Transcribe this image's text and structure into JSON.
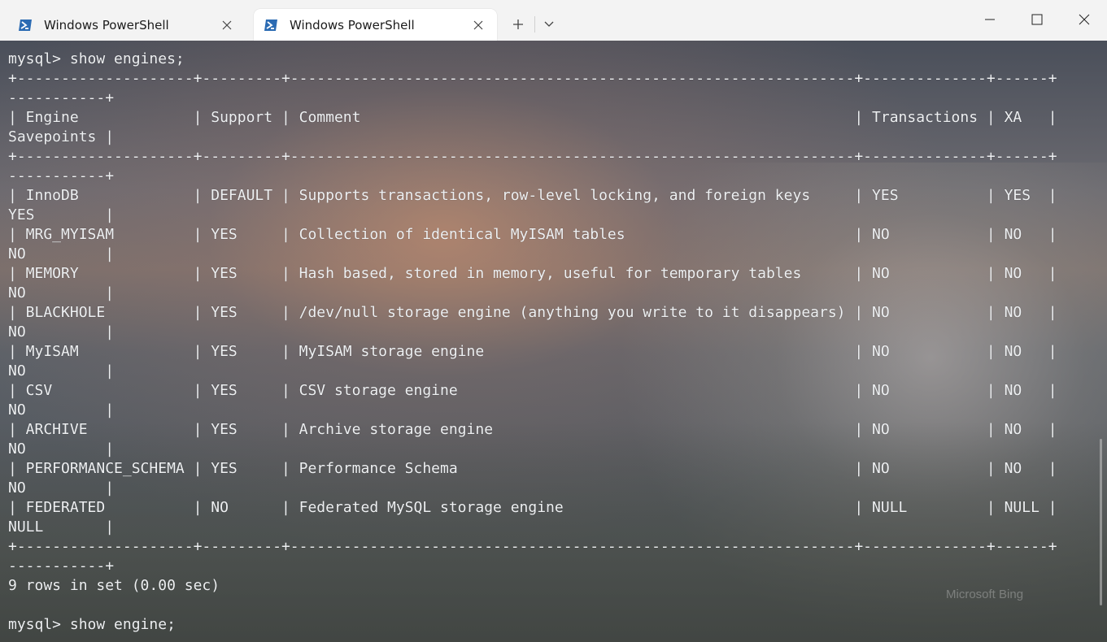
{
  "tabs": [
    {
      "title": "Windows PowerShell",
      "active": false
    },
    {
      "title": "Windows PowerShell",
      "active": true
    }
  ],
  "window_controls": {
    "minimize": "minimize-icon",
    "maximize": "maximize-icon",
    "close": "close-icon"
  },
  "terminal": {
    "lines": [
      "mysql> show engines;",
      "+--------------------+---------+----------------------------------------------------------------+--------------+------+",
      "-----------+",
      "| Engine             | Support | Comment                                                        | Transactions | XA   |",
      "Savepoints |",
      "+--------------------+---------+----------------------------------------------------------------+--------------+------+",
      "-----------+",
      "| InnoDB             | DEFAULT | Supports transactions, row-level locking, and foreign keys     | YES          | YES  |",
      "YES        |",
      "| MRG_MYISAM         | YES     | Collection of identical MyISAM tables                          | NO           | NO   |",
      "NO         |",
      "| MEMORY             | YES     | Hash based, stored in memory, useful for temporary tables      | NO           | NO   |",
      "NO         |",
      "| BLACKHOLE          | YES     | /dev/null storage engine (anything you write to it disappears) | NO           | NO   |",
      "NO         |",
      "| MyISAM             | YES     | MyISAM storage engine                                          | NO           | NO   |",
      "NO         |",
      "| CSV                | YES     | CSV storage engine                                             | NO           | NO   |",
      "NO         |",
      "| ARCHIVE            | YES     | Archive storage engine                                         | NO           | NO   |",
      "NO         |",
      "| PERFORMANCE_SCHEMA | YES     | Performance Schema                                             | NO           | NO   |",
      "NO         |",
      "| FEDERATED          | NO      | Federated MySQL storage engine                                 | NULL         | NULL |",
      "NULL       |",
      "+--------------------+---------+----------------------------------------------------------------+--------------+------+",
      "-----------+",
      "9 rows in set (0.00 sec)",
      "",
      "mysql> show engine;"
    ]
  },
  "wallpaper_watermark": "Microsoft Bing",
  "colors": {
    "titlebar": "#f3f3f3",
    "active_tab": "#ffffff",
    "terminal_text": "#eef0f2",
    "ps_icon": "#2b6bb3"
  }
}
